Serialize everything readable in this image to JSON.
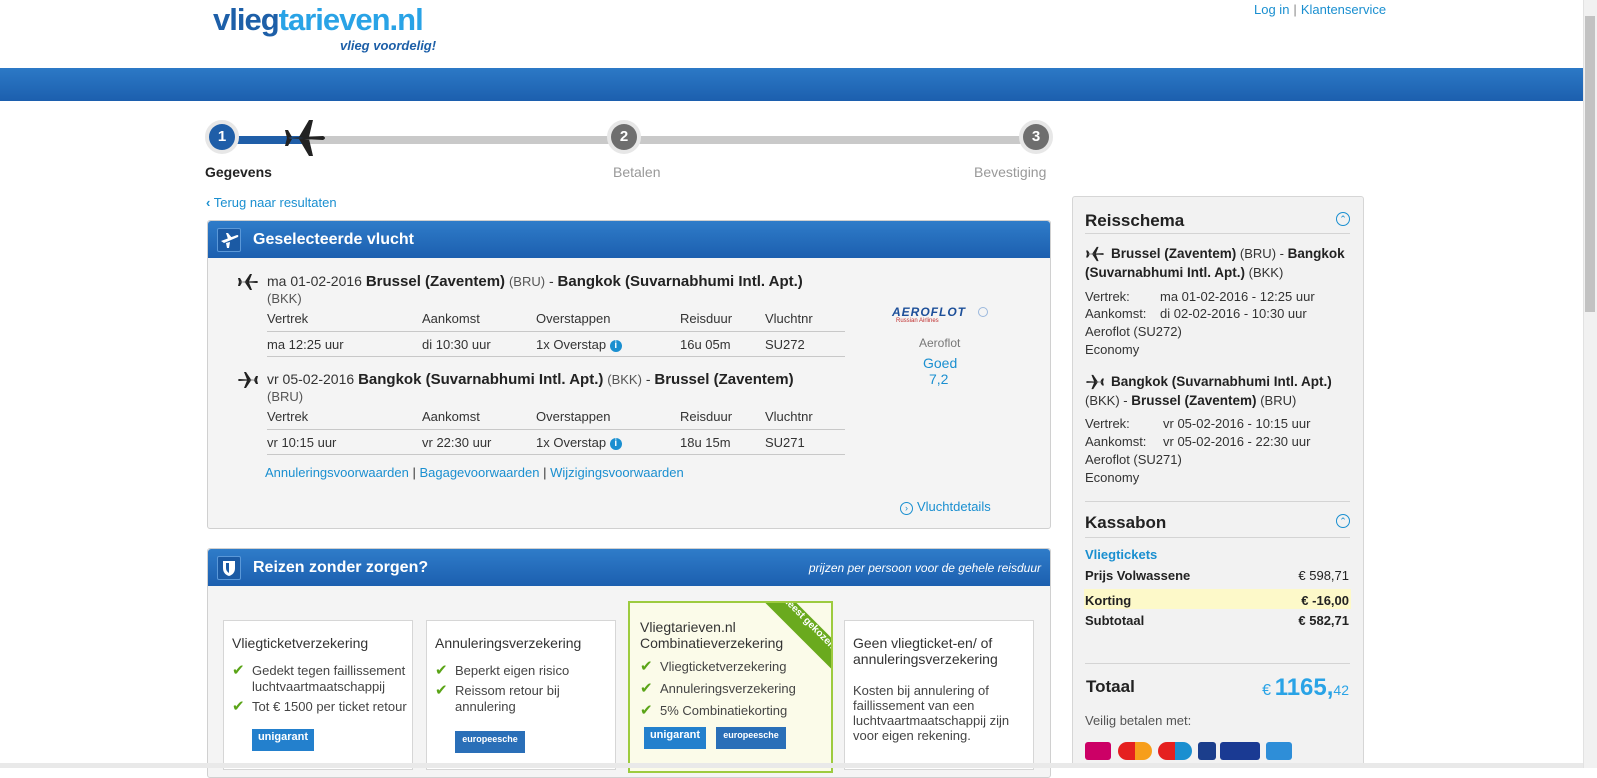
{
  "header": {
    "logo_part1": "vlieg",
    "logo_part2": "tarieven.nl",
    "tagline": "vlieg voordelig!",
    "login": "Log in",
    "separator": "|",
    "service": "Klantenservice"
  },
  "steps": [
    {
      "number": "1",
      "label": "Gegevens",
      "active": true
    },
    {
      "number": "2",
      "label": "Betalen",
      "active": false
    },
    {
      "number": "3",
      "label": "Bevestiging",
      "active": false
    }
  ],
  "back_link": "Terug naar resultaten",
  "selected_flight": {
    "title": "Geselecteerde vlucht",
    "columns": [
      "Vertrek",
      "Aankomst",
      "Overstappen",
      "Reisduur",
      "Vluchtnr"
    ],
    "outbound": {
      "date": "ma 01-02-2016",
      "from": "Brussel (Zaventem)",
      "from_code": "(BRU)",
      "dash": "-",
      "to": "Bangkok (Suvarnabhumi Intl. Apt.)",
      "to_code": "(BKK)",
      "departure": "ma 12:25 uur",
      "arrival": "di 10:30 uur",
      "stops": "1x Overstap",
      "duration": "16u 05m",
      "flight_no": "SU272"
    },
    "inbound": {
      "date": "vr 05-02-2016",
      "from": "Bangkok (Suvarnabhumi Intl. Apt.)",
      "from_code": "(BKK)",
      "dash": "-",
      "to": "Brussel (Zaventem)",
      "to_code": "(BRU)",
      "departure": "vr 10:15 uur",
      "arrival": "vr 22:30 uur",
      "stops": "1x Overstap",
      "duration": "18u 15m",
      "flight_no": "SU271"
    },
    "airline_logo": "AEROFLOT",
    "airline_logo_sub": "Russian Airlines",
    "airline": "Aeroflot",
    "rating_label": "Goed",
    "rating_value": "7,2",
    "link_cancel": "Annuleringsvoorwaarden",
    "link_baggage": "Bagagevoorwaarden",
    "link_change": "Wijzigingsvoorwaarden",
    "link_sep": "|",
    "details": "Vluchtdetails"
  },
  "insurance": {
    "title": "Reizen zonder zorgen?",
    "subtitle": "prijzen per persoon voor de gehele reisduur",
    "cards": [
      {
        "title": "Vliegticketverzekering",
        "items": [
          "Gedekt tegen faillissement luchtvaartmaatschappij",
          "Tot € 1500 per ticket retour"
        ],
        "brand": "unigarant"
      },
      {
        "title": "Annuleringsverzekering",
        "items": [
          "Beperkt eigen risico",
          "Reissom retour bij annulering"
        ],
        "brand": "europeesche"
      },
      {
        "title": "Vliegtarieven.nl Combinatieverzekering",
        "badge": "meest gekozen",
        "items": [
          "Vliegticketverzekering",
          "Annuleringsverzekering",
          "5% Combinatiekorting"
        ],
        "brand1": "unigarant",
        "brand2": "europeesche"
      },
      {
        "title": "Geen vliegticket-en/ of annuleringsverzekering",
        "text": "Kosten bij annulering of faillissement van een luchtvaartmaatschappij zijn voor eigen rekening."
      }
    ]
  },
  "itinerary": {
    "title": "Reisschema",
    "outbound": {
      "from": "Brussel (Zaventem)",
      "from_code": "(BRU)",
      "dash": "-",
      "to": "Bangkok",
      "to2": "(Suvarnabhumi Intl. Apt.)",
      "to_code": "(BKK)",
      "dep_label": "Vertrek:",
      "dep": "ma 01-02-2016 - 12:25 uur",
      "arr_label": "Aankomst:",
      "arr": "di 02-02-2016 - 10:30 uur",
      "carrier": "Aeroflot (SU272)",
      "cabin": "Economy"
    },
    "inbound": {
      "from": "Bangkok (Suvarnabhumi Intl. Apt.)",
      "from_code": "(BKK)",
      "dash": "-",
      "to": "Brussel (Zaventem)",
      "to_code": "(BRU)",
      "dep_label": "Vertrek:",
      "dep": "vr 05-02-2016 - 10:15 uur",
      "arr_label": "Aankomst:",
      "arr": "vr 05-02-2016 - 22:30 uur",
      "carrier": "Aeroflot (SU271)",
      "cabin": "Economy"
    }
  },
  "receipt": {
    "title": "Kassabon",
    "section": "Vliegtickets",
    "rows": [
      {
        "label": "Prijs Volwassene",
        "value": "€ 598,71"
      },
      {
        "label": "Korting",
        "value": "€ -16,00"
      },
      {
        "label": "Subtotaal",
        "value": "€ 582,71"
      }
    ],
    "total_label": "Totaal",
    "total_currency": "€",
    "total_int": "1165,",
    "total_dec": "42",
    "pay_label": "Veilig betalen met:"
  },
  "colors": {
    "brand_blue": "#1d5fa8",
    "link_blue": "#1a8fd0",
    "check_green": "#5aa417",
    "highlight": "#fdf9c9"
  }
}
